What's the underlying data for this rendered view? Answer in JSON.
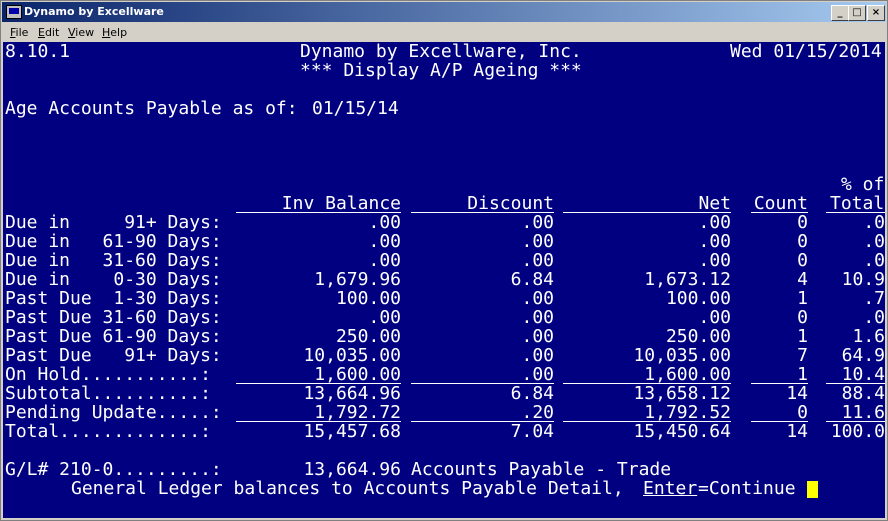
{
  "window": {
    "title": "Dynamo by Excellware"
  },
  "menu": [
    {
      "label": "File",
      "mnemonic": "F",
      "rest": "ile"
    },
    {
      "label": "Edit",
      "mnemonic": "E",
      "rest": "dit"
    },
    {
      "label": "View",
      "mnemonic": "V",
      "rest": "iew"
    },
    {
      "label": "Help",
      "mnemonic": "H",
      "rest": "elp"
    }
  ],
  "header": {
    "version": "8.10.1",
    "company": "Dynamo by Excellware, Inc.",
    "screen_title": "*** Display A/P Ageing ***",
    "date": "Wed 01/15/2014"
  },
  "age_prompt": {
    "label": "Age Accounts Payable as of:",
    "value": "01/15/14"
  },
  "columns": {
    "inv_balance": "Inv Balance",
    "discount": "Discount",
    "net": "Net",
    "count": "Count",
    "pct_line1": "% of",
    "pct_line2": "Total"
  },
  "rows": [
    {
      "label": "Due in     91+ Days:",
      "inv": ".00",
      "disc": ".00",
      "net": ".00",
      "count": "0",
      "pct": ".0"
    },
    {
      "label": "Due in   61-90 Days:",
      "inv": ".00",
      "disc": ".00",
      "net": ".00",
      "count": "0",
      "pct": ".0"
    },
    {
      "label": "Due in   31-60 Days:",
      "inv": ".00",
      "disc": ".00",
      "net": ".00",
      "count": "0",
      "pct": ".0"
    },
    {
      "label": "Due in    0-30 Days:",
      "inv": "1,679.96",
      "disc": "6.84",
      "net": "1,673.12",
      "count": "4",
      "pct": "10.9"
    },
    {
      "label": "Past Due  1-30 Days:",
      "inv": "100.00",
      "disc": ".00",
      "net": "100.00",
      "count": "1",
      "pct": ".7"
    },
    {
      "label": "Past Due 31-60 Days:",
      "inv": ".00",
      "disc": ".00",
      "net": ".00",
      "count": "0",
      "pct": ".0"
    },
    {
      "label": "Past Due 61-90 Days:",
      "inv": "250.00",
      "disc": ".00",
      "net": "250.00",
      "count": "1",
      "pct": "1.6"
    },
    {
      "label": "Past Due   91+ Days:",
      "inv": "10,035.00",
      "disc": ".00",
      "net": "10,035.00",
      "count": "7",
      "pct": "64.9"
    },
    {
      "label": "On Hold...........:",
      "inv": "1,600.00",
      "disc": ".00",
      "net": "1,600.00",
      "count": "1",
      "pct": "10.4"
    },
    {
      "label": "Subtotal..........:",
      "inv": "13,664.96",
      "disc": "6.84",
      "net": "13,658.12",
      "count": "14",
      "pct": "88.4"
    },
    {
      "label": "Pending Update.....:",
      "inv": "1,792.72",
      "disc": ".20",
      "net": "1,792.52",
      "count": "0",
      "pct": "11.6"
    },
    {
      "label": "Total.............:",
      "inv": "15,457.68",
      "disc": "7.04",
      "net": "15,450.64",
      "count": "14",
      "pct": "100.0"
    }
  ],
  "gl": {
    "label": "G/L# 210-0.........:",
    "amount": "13,664.96",
    "description": "Accounts Payable - Trade"
  },
  "footer": {
    "message": "General Ledger balances to Accounts Payable Detail,",
    "key": "Enter",
    "action": "=Continue"
  }
}
